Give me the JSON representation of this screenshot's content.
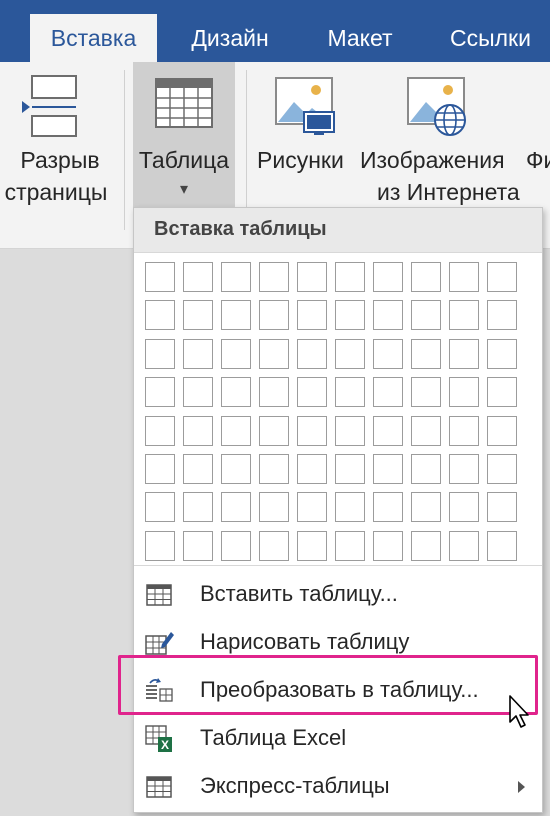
{
  "tabs": [
    {
      "label": "Вставка",
      "active": true
    },
    {
      "label": "Дизайн"
    },
    {
      "label": "Макет"
    },
    {
      "label": "Ссылки"
    }
  ],
  "ribbon": {
    "page_break": {
      "line1": "Разрыв",
      "line2": "страницы"
    },
    "table": {
      "label": "Таблица",
      "arrow": "▾"
    },
    "pictures": {
      "label": "Рисунки"
    },
    "online_pictures": {
      "line1": "Изображения",
      "line2": "из Интернета"
    },
    "cut_label": "Фи"
  },
  "menu": {
    "header": "Вставка таблицы",
    "grid": {
      "columns": 10,
      "rows": 8
    },
    "items": [
      {
        "label": "Вставить таблицу...",
        "icon": "table-grid-icon"
      },
      {
        "label": "Нарисовать таблицу",
        "icon": "draw-table-pencil-icon"
      },
      {
        "label": "Преобразовать в таблицу...",
        "icon": "convert-text-to-table-icon",
        "highlighted": true
      },
      {
        "label": "Таблица Excel",
        "icon": "excel-table-icon"
      },
      {
        "label": "Экспресс-таблицы",
        "icon": "quick-tables-icon",
        "submenu": true
      }
    ]
  },
  "colors": {
    "brand": "#2b579a",
    "highlight": "#e0248c",
    "excel": "#1e7145",
    "ribbon_bg": "#f3f3f3"
  }
}
